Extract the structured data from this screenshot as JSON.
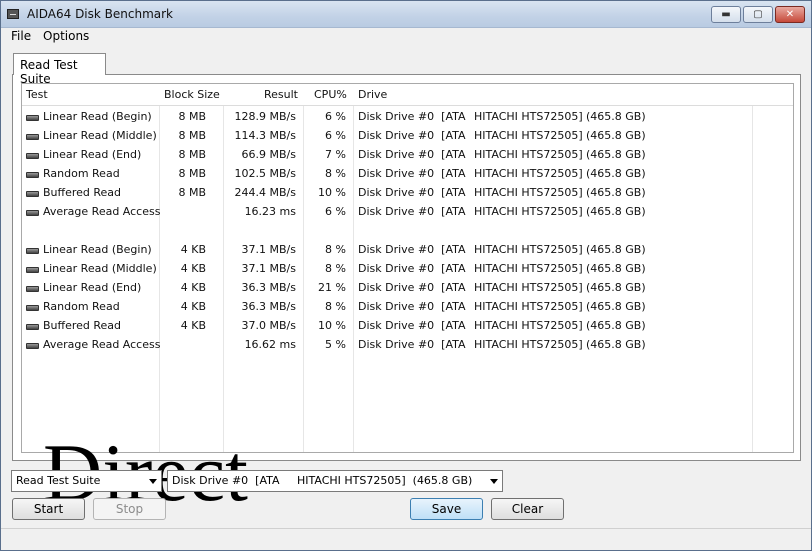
{
  "window": {
    "title": "AIDA64 Disk Benchmark",
    "min_label": "▬",
    "max_label": "▢",
    "close_label": "✕"
  },
  "menu": {
    "file": "File",
    "options": "Options"
  },
  "tab": {
    "label": "Read Test Suite"
  },
  "table": {
    "headers": {
      "test": "Test",
      "block": "Block Size",
      "result": "Result",
      "cpu": "CPU%",
      "drive": "Drive"
    },
    "rows": [
      {
        "test": "Linear Read (Begin)",
        "block": "8 MB",
        "result": "128.9 MB/s",
        "cpu": "6 %",
        "drive": "Disk Drive #0  [ATA",
        "model": "HITACHI HTS72505]",
        "size": "(465.8 GB)"
      },
      {
        "test": "Linear Read (Middle)",
        "block": "8 MB",
        "result": "114.3 MB/s",
        "cpu": "6 %",
        "drive": "Disk Drive #0  [ATA",
        "model": "HITACHI HTS72505]",
        "size": "(465.8 GB)"
      },
      {
        "test": "Linear Read (End)",
        "block": "8 MB",
        "result": "66.9 MB/s",
        "cpu": "7 %",
        "drive": "Disk Drive #0  [ATA",
        "model": "HITACHI HTS72505]",
        "size": "(465.8 GB)"
      },
      {
        "test": "Random Read",
        "block": "8 MB",
        "result": "102.5 MB/s",
        "cpu": "8 %",
        "drive": "Disk Drive #0  [ATA",
        "model": "HITACHI HTS72505]",
        "size": "(465.8 GB)"
      },
      {
        "test": "Buffered Read",
        "block": "8 MB",
        "result": "244.4 MB/s",
        "cpu": "10 %",
        "drive": "Disk Drive #0  [ATA",
        "model": "HITACHI HTS72505]",
        "size": "(465.8 GB)"
      },
      {
        "test": "Average Read Access",
        "block": "",
        "result": "16.23 ms",
        "cpu": "6 %",
        "drive": "Disk Drive #0  [ATA",
        "model": "HITACHI HTS72505]",
        "size": "(465.8 GB)"
      },
      {
        "test": "Linear Read (Begin)",
        "block": "4 KB",
        "result": "37.1 MB/s",
        "cpu": "8 %",
        "drive": "Disk Drive #0  [ATA",
        "model": "HITACHI HTS72505]",
        "size": "(465.8 GB)"
      },
      {
        "test": "Linear Read (Middle)",
        "block": "4 KB",
        "result": "37.1 MB/s",
        "cpu": "8 %",
        "drive": "Disk Drive #0  [ATA",
        "model": "HITACHI HTS72505]",
        "size": "(465.8 GB)"
      },
      {
        "test": "Linear Read (End)",
        "block": "4 KB",
        "result": "36.3 MB/s",
        "cpu": "21 %",
        "drive": "Disk Drive #0  [ATA",
        "model": "HITACHI HTS72505]",
        "size": "(465.8 GB)"
      },
      {
        "test": "Random Read",
        "block": "4 KB",
        "result": "36.3 MB/s",
        "cpu": "8 %",
        "drive": "Disk Drive #0  [ATA",
        "model": "HITACHI HTS72505]",
        "size": "(465.8 GB)"
      },
      {
        "test": "Buffered Read",
        "block": "4 KB",
        "result": "37.0 MB/s",
        "cpu": "10 %",
        "drive": "Disk Drive #0  [ATA",
        "model": "HITACHI HTS72505]",
        "size": "(465.8 GB)"
      },
      {
        "test": "Average Read Access",
        "block": "",
        "result": "16.62 ms",
        "cpu": "5 %",
        "drive": "Disk Drive #0  [ATA",
        "model": "HITACHI HTS72505]",
        "size": "(465.8 GB)"
      }
    ]
  },
  "overlay": {
    "text": "Direct"
  },
  "controls": {
    "suite_select": "Read Test Suite",
    "drive_select": "Disk Drive #0  [ATA     HITACHI HTS72505]  (465.8 GB)",
    "start": "Start",
    "stop": "Stop",
    "save": "Save",
    "clear": "Clear"
  }
}
